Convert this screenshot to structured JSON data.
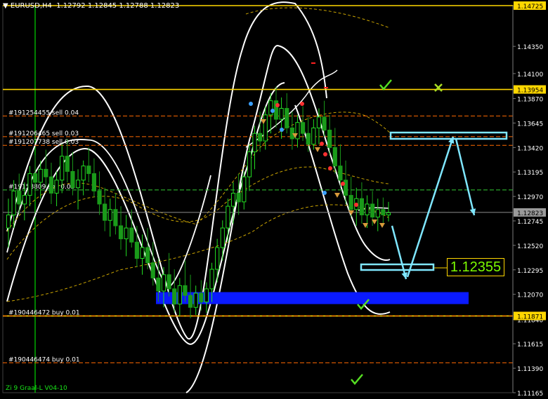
{
  "header": {
    "arrow": "▼",
    "symbol": "EURUSD,H4",
    "open": "1.12792",
    "high": "1.12845",
    "low": "1.12788",
    "close": "1.12823"
  },
  "footer": {
    "indicator": "Zi 9 Graal-L V04-10"
  },
  "callout": {
    "value": "1.12355"
  },
  "chart_data": {
    "type": "line",
    "title": "EURUSD,H4",
    "ylim": [
      1.11165,
      1.14725
    ],
    "y_ticks": [
      "1.14725",
      "1.14350",
      "1.14100",
      "1.13870",
      "1.13645",
      "1.13420",
      "1.13195",
      "1.12970",
      "1.12745",
      "1.12520",
      "1.12295",
      "1.12070",
      "1.11840",
      "1.11615",
      "1.11390",
      "1.11165"
    ],
    "current_price": "1.12823",
    "price_tags": [
      {
        "value": 1.14725,
        "label": "1.14725",
        "style": "yellow"
      },
      {
        "value": 1.13954,
        "label": "1.13954",
        "style": "yellow"
      },
      {
        "value": 1.12823,
        "label": "1.12823",
        "style": "gray"
      },
      {
        "value": 1.11871,
        "label": "1.11871",
        "style": "yellow"
      }
    ],
    "levels": [
      {
        "value": 1.14725,
        "kind": "solid-yellow"
      },
      {
        "value": 1.13954,
        "kind": "solid-yellow"
      },
      {
        "value": 1.11871,
        "kind": "solid-yellow"
      },
      {
        "value": 1.12823,
        "kind": "gray"
      }
    ],
    "order_lines": [
      {
        "value": 1.1371,
        "label": "#191254455 sell 0.04",
        "color": "#ff6a00"
      },
      {
        "value": 1.1352,
        "label": "#191206465 sell 0.03",
        "color": "#ff6a00"
      },
      {
        "value": 1.1344,
        "label": "#191207738 sell 0.03",
        "color": "#ff6a00"
      },
      {
        "value": 1.1303,
        "label": "#19158809 sell 0.03",
        "color": "#33cc33"
      },
      {
        "value": 1.11871,
        "label": "#190446472 buy 0.01",
        "color": "#ff6a00"
      },
      {
        "value": 1.1144,
        "label": "#190446474 buy 0.01",
        "color": "#ff6a00"
      }
    ],
    "zones": [
      {
        "name": "blue-support-zone",
        "from": 1.1198,
        "to": 1.1209,
        "color": "#0a1aff"
      }
    ],
    "candles": [
      [
        1.1268,
        1.1295,
        1.125,
        1.128
      ],
      [
        1.128,
        1.1312,
        1.1268,
        1.1302
      ],
      [
        1.1302,
        1.1318,
        1.128,
        1.129
      ],
      [
        1.129,
        1.131,
        1.1275,
        1.1298
      ],
      [
        1.1298,
        1.1325,
        1.1288,
        1.1318
      ],
      [
        1.1318,
        1.1335,
        1.13,
        1.131
      ],
      [
        1.131,
        1.133,
        1.1295,
        1.1322
      ],
      [
        1.1322,
        1.134,
        1.1305,
        1.1315
      ],
      [
        1.1315,
        1.1328,
        1.129,
        1.13
      ],
      [
        1.13,
        1.132,
        1.1288,
        1.1312
      ],
      [
        1.1312,
        1.1345,
        1.13,
        1.1334
      ],
      [
        1.1334,
        1.135,
        1.131,
        1.132
      ],
      [
        1.132,
        1.1338,
        1.1298,
        1.1305
      ],
      [
        1.1305,
        1.1322,
        1.1285,
        1.1312
      ],
      [
        1.1312,
        1.133,
        1.1298,
        1.1325
      ],
      [
        1.1325,
        1.1342,
        1.131,
        1.1318
      ],
      [
        1.1318,
        1.1332,
        1.1296,
        1.1302
      ],
      [
        1.1302,
        1.132,
        1.128,
        1.129
      ],
      [
        1.129,
        1.1305,
        1.1265,
        1.1275
      ],
      [
        1.1275,
        1.1295,
        1.126,
        1.1285
      ],
      [
        1.1285,
        1.13,
        1.1262,
        1.127
      ],
      [
        1.127,
        1.1288,
        1.1248,
        1.1258
      ],
      [
        1.1258,
        1.128,
        1.1242,
        1.1268
      ],
      [
        1.1268,
        1.1285,
        1.125,
        1.1255
      ],
      [
        1.1255,
        1.127,
        1.1232,
        1.124
      ],
      [
        1.124,
        1.1262,
        1.1225,
        1.125
      ],
      [
        1.125,
        1.1268,
        1.123,
        1.1236
      ],
      [
        1.1236,
        1.1255,
        1.1215,
        1.1222
      ],
      [
        1.1222,
        1.124,
        1.12,
        1.121
      ],
      [
        1.121,
        1.1232,
        1.1195,
        1.1225
      ],
      [
        1.1225,
        1.1245,
        1.1205,
        1.1212
      ],
      [
        1.1212,
        1.123,
        1.119,
        1.1198
      ],
      [
        1.1198,
        1.1222,
        1.1187,
        1.1215
      ],
      [
        1.1215,
        1.1238,
        1.12,
        1.1206
      ],
      [
        1.1206,
        1.1225,
        1.1185,
        1.1195
      ],
      [
        1.1195,
        1.1215,
        1.1188,
        1.1208
      ],
      [
        1.1208,
        1.122,
        1.1192,
        1.12
      ],
      [
        1.12,
        1.1218,
        1.119,
        1.1212
      ],
      [
        1.1212,
        1.1236,
        1.12,
        1.123
      ],
      [
        1.123,
        1.1258,
        1.1218,
        1.125
      ],
      [
        1.125,
        1.1275,
        1.1238,
        1.1268
      ],
      [
        1.1268,
        1.1295,
        1.1255,
        1.1288
      ],
      [
        1.1288,
        1.131,
        1.1272,
        1.13
      ],
      [
        1.13,
        1.1318,
        1.128,
        1.1292
      ],
      [
        1.1292,
        1.132,
        1.1285,
        1.1315
      ],
      [
        1.1315,
        1.1345,
        1.1302,
        1.1338
      ],
      [
        1.1338,
        1.1362,
        1.1322,
        1.1355
      ],
      [
        1.1355,
        1.1375,
        1.1338,
        1.1348
      ],
      [
        1.1348,
        1.138,
        1.134,
        1.1372
      ],
      [
        1.1372,
        1.1392,
        1.1355,
        1.1385
      ],
      [
        1.1385,
        1.1398,
        1.136,
        1.1368
      ],
      [
        1.1368,
        1.1388,
        1.135,
        1.1378
      ],
      [
        1.1378,
        1.1392,
        1.1355,
        1.136
      ],
      [
        1.136,
        1.1375,
        1.134,
        1.135
      ],
      [
        1.135,
        1.1372,
        1.1342,
        1.1365
      ],
      [
        1.1365,
        1.138,
        1.1348,
        1.1355
      ],
      [
        1.1355,
        1.137,
        1.1338,
        1.1345
      ],
      [
        1.1345,
        1.1368,
        1.134,
        1.136
      ],
      [
        1.136,
        1.1378,
        1.1345,
        1.137
      ],
      [
        1.137,
        1.1385,
        1.1352,
        1.1358
      ],
      [
        1.1358,
        1.1372,
        1.1335,
        1.1342
      ],
      [
        1.1342,
        1.136,
        1.1318,
        1.1325
      ],
      [
        1.1325,
        1.1345,
        1.1305,
        1.1312
      ],
      [
        1.1312,
        1.133,
        1.129,
        1.1298
      ],
      [
        1.1298,
        1.1315,
        1.1278,
        1.1285
      ],
      [
        1.1285,
        1.1305,
        1.127,
        1.1295
      ],
      [
        1.1295,
        1.131,
        1.1272,
        1.128
      ],
      [
        1.128,
        1.1298,
        1.1268,
        1.129
      ],
      [
        1.129,
        1.1302,
        1.127,
        1.1278
      ],
      [
        1.1278,
        1.1295,
        1.1265,
        1.1285
      ],
      [
        1.1285,
        1.1296,
        1.1272,
        1.128
      ],
      [
        1.128,
        1.1292,
        1.1274,
        1.1282
      ]
    ],
    "trade_arrows": [
      {
        "from": [
          34,
          1.12823
        ],
        "to": [
          40,
          1.123
        ],
        "meaning": "projected drop"
      },
      {
        "from": [
          40,
          1.123
        ],
        "to": [
          46,
          1.1357
        ],
        "meaning": "projected rise"
      },
      {
        "from": [
          46,
          1.1357
        ],
        "to": [
          49,
          1.1287
        ],
        "meaning": "projected pullback"
      }
    ]
  }
}
